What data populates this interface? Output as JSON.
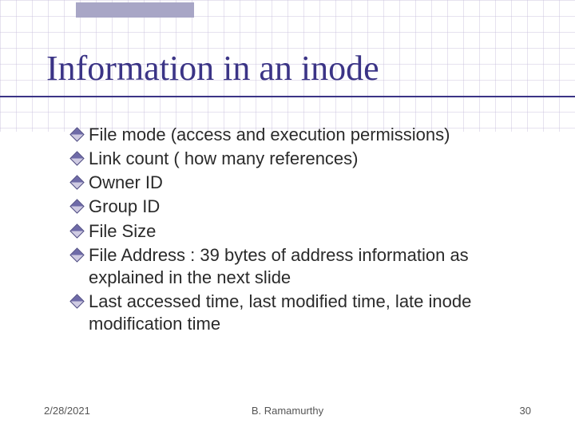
{
  "title": "Information in an inode",
  "bullets": [
    "File mode (access and execution permissions)",
    "Link count ( how many references)",
    "Owner ID",
    "Group ID",
    "File Size",
    "File Address : 39 bytes of address information as explained in the next slide",
    "Last accessed time, last modified time, late inode modification time"
  ],
  "footer": {
    "date": "2/28/2021",
    "author": "B. Ramamurthy",
    "page": "30"
  }
}
